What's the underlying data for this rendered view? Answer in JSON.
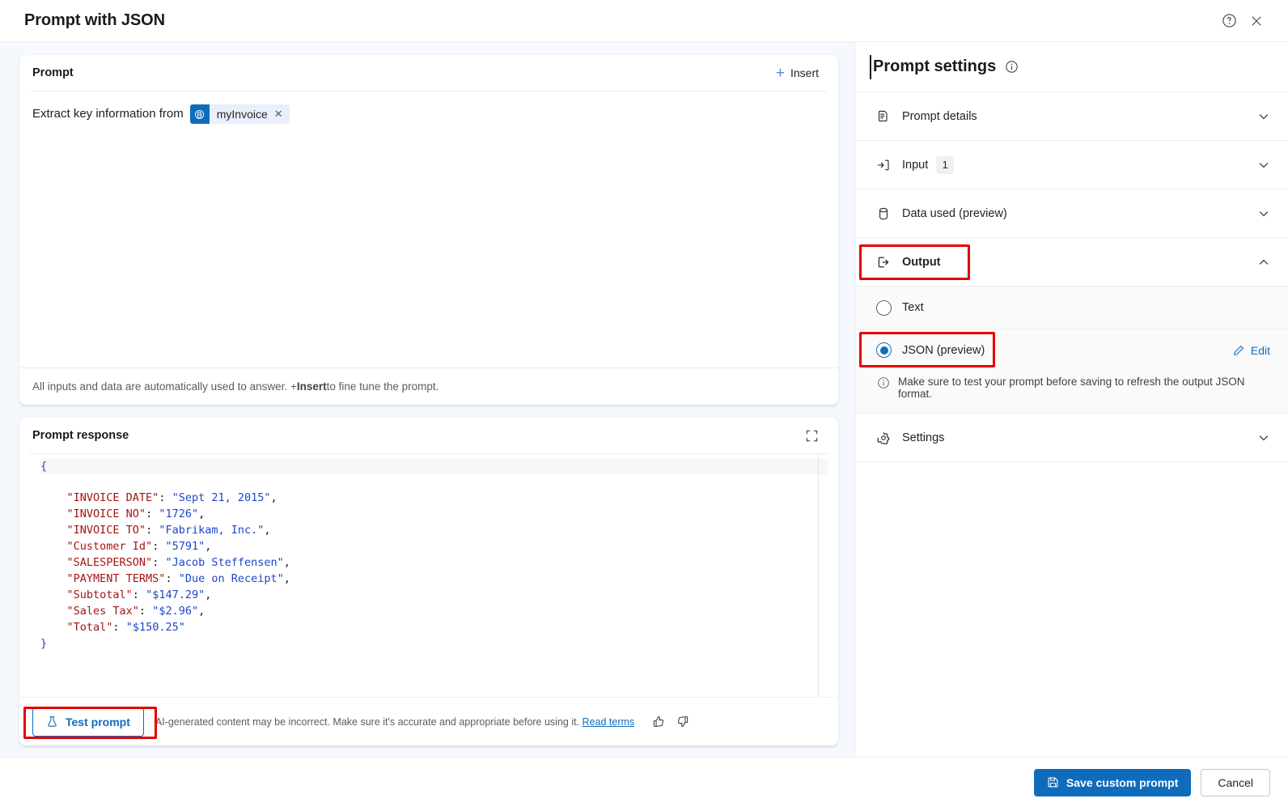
{
  "window": {
    "title": "Prompt with JSON",
    "help_icon": "help-circle-icon",
    "close_icon": "close-icon"
  },
  "prompt_card": {
    "title": "Prompt",
    "insert_label": "Insert",
    "text_before_chip": "Extract key information from",
    "chip": {
      "label": "myInvoice",
      "icon": "dataverse-table-icon",
      "close": "✕"
    },
    "footer_note_part1": "All inputs and data are automatically used to answer. + ",
    "footer_note_bold": "Insert",
    "footer_note_part2": " to fine tune the prompt."
  },
  "response_card": {
    "title": "Prompt response",
    "expand_icon": "expand-icon",
    "json_lines": [
      {
        "indent": 0,
        "open": "{"
      },
      {
        "indent": 1,
        "key": "\"INVOICE DATE\"",
        "value": "\"Sept 21, 2015\"",
        "comma": true
      },
      {
        "indent": 1,
        "key": "\"INVOICE NO\"",
        "value": "\"1726\"",
        "comma": true
      },
      {
        "indent": 1,
        "key": "\"INVOICE TO\"",
        "value": "\"Fabrikam, Inc.\"",
        "comma": true
      },
      {
        "indent": 1,
        "key": "\"Customer Id\"",
        "value": "\"5791\"",
        "comma": true
      },
      {
        "indent": 1,
        "key": "\"SALESPERSON\"",
        "value": "\"Jacob Steffensen\"",
        "comma": true
      },
      {
        "indent": 1,
        "key": "\"PAYMENT TERMS\"",
        "value": "\"Due on Receipt\"",
        "comma": true
      },
      {
        "indent": 1,
        "key": "\"Subtotal\"",
        "value": "\"$147.29\"",
        "comma": true
      },
      {
        "indent": 1,
        "key": "\"Sales Tax\"",
        "value": "\"$2.96\"",
        "comma": true
      },
      {
        "indent": 1,
        "key": "\"Total\"",
        "value": "\"$150.25\"",
        "comma": false
      },
      {
        "indent": 0,
        "close": "}"
      }
    ],
    "test_button": {
      "label": "Test prompt",
      "icon": "beaker-icon"
    },
    "disclaimer": "AI-generated content may be incorrect. Make sure it's accurate and appropriate before using it.",
    "read_terms": "Read terms",
    "thumbs_up_icon": "thumbs-up-icon",
    "thumbs_down_icon": "thumbs-down-icon"
  },
  "settings_panel": {
    "title": "Prompt settings",
    "info_icon": "info-circle-icon",
    "sections": [
      {
        "label": "Prompt details",
        "icon": "document-icon",
        "expanded": false
      },
      {
        "label": "Input",
        "icon": "arrow-into-box-icon",
        "badge": "1",
        "expanded": false
      },
      {
        "label": "Data used (preview)",
        "icon": "database-icon",
        "expanded": false
      },
      {
        "label": "Output",
        "icon": "arrow-out-box-icon",
        "expanded": true
      },
      {
        "label": "Settings",
        "icon": "gear-icon",
        "expanded": false
      }
    ],
    "output": {
      "options": [
        {
          "label": "Text",
          "selected": false
        },
        {
          "label": "JSON (preview)",
          "selected": true
        }
      ],
      "edit_label": "Edit",
      "edit_icon": "pencil-icon",
      "note": "Make sure to test your prompt before saving to refresh the output JSON format.",
      "note_icon": "info-circle-icon"
    }
  },
  "footer": {
    "save_label": "Save custom prompt",
    "save_icon": "save-icon",
    "cancel_label": "Cancel"
  },
  "colors": {
    "accent": "#0f6cbd",
    "highlight": "#e60000",
    "json_key": "#a31515",
    "json_value": "#1f45cc",
    "page_bg": "#f5f9fe"
  }
}
